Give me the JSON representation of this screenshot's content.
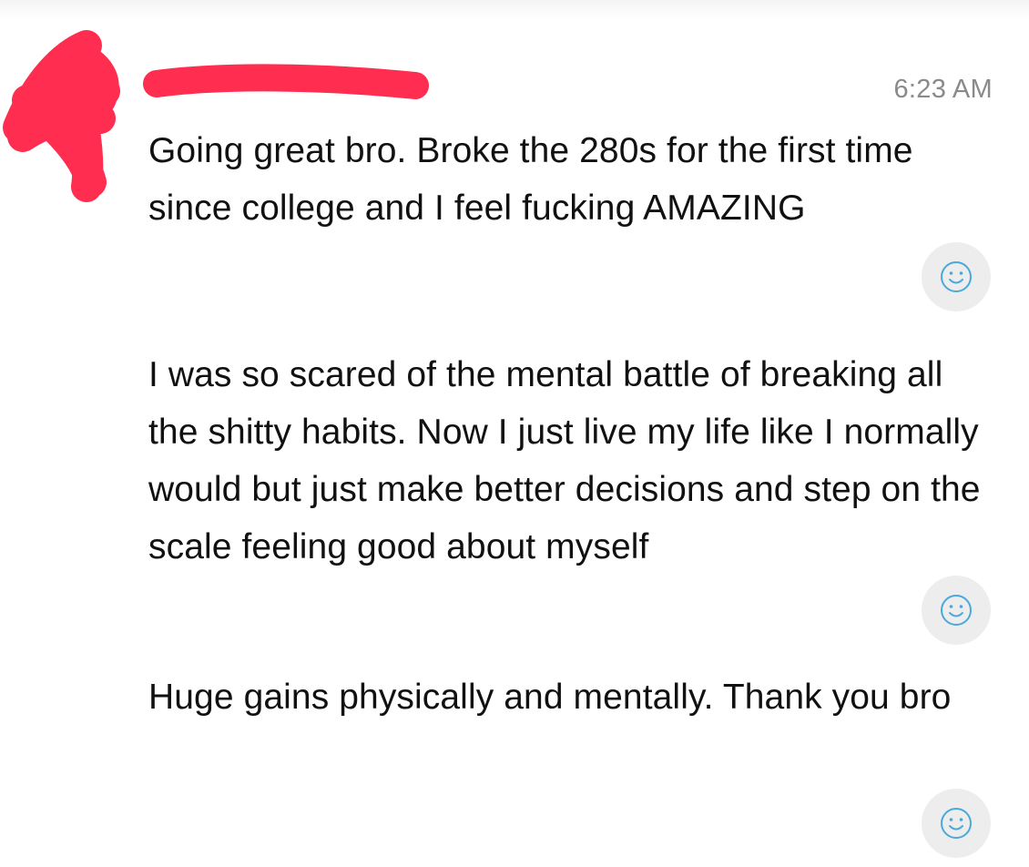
{
  "conversation": {
    "timestamp": "6:23 AM",
    "messages": [
      {
        "text": "Going great bro. Broke the 280s for the first time since college and I feel fucking AMAZING",
        "reaction_icon": "smiley-icon"
      },
      {
        "text": "I was so scared of the mental battle of breaking all the shitty habits. Now I just live my life like I normally would but just make better decisions and step on the scale feeling good about myself",
        "reaction_icon": "smiley-icon"
      },
      {
        "text": "Huge gains physically and mentally. Thank you bro",
        "reaction_icon": "smiley-icon"
      }
    ]
  },
  "colors": {
    "redaction": "#ff2d4f",
    "timestamp": "#8a8a8a",
    "reaction_icon": "#49a9dc",
    "reaction_bg": "#ededed"
  }
}
